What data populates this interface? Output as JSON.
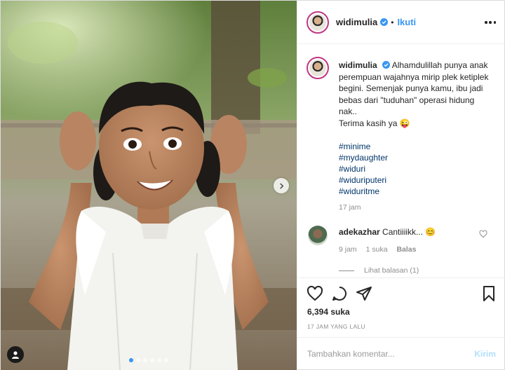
{
  "colors": {
    "accent": "#3897f0",
    "hashtag": "#003569",
    "muted": "#8e8e8e",
    "verified": "#3897f0"
  },
  "post": {
    "username": "widimulia",
    "follow_label": "Ikuti",
    "bullet": "•",
    "more_icon": "more-horizontal-icon",
    "image": {
      "alt_subject": "girl in white sleeveless top making a surprised face",
      "carousel_dots": 6,
      "active_dot": 1
    }
  },
  "caption": {
    "username": "widimulia",
    "text": "Alhamdulillah punya anak perempuan wajahnya mirip plek ketiplek begini. Semenjak punya kamu, ibu jadi bebas dari \"tuduhan\" operasi hidung nak..",
    "thanks": "Terima kasih ya 😜",
    "hashtags": [
      "#minime",
      "#mydaughter",
      "#widuri",
      "#widuriputeri",
      "#widuritme"
    ],
    "time": "17 jam"
  },
  "comments": [
    {
      "username": "adekazhar",
      "text": "Cantiiiikk... 😊",
      "time": "9 jam",
      "likes": "1 suka",
      "reply_label": "Balas",
      "view_replies": "Lihat balasan (1)"
    }
  ],
  "actions": {
    "like_icon": "heart-icon",
    "comment_icon": "comment-icon",
    "share_icon": "share-icon",
    "save_icon": "bookmark-icon",
    "likes_count": "6,394 suka",
    "posted_ago": "17 JAM YANG LALU"
  },
  "composer": {
    "placeholder": "Tambahkan komentar...",
    "post_label": "Kirim"
  }
}
